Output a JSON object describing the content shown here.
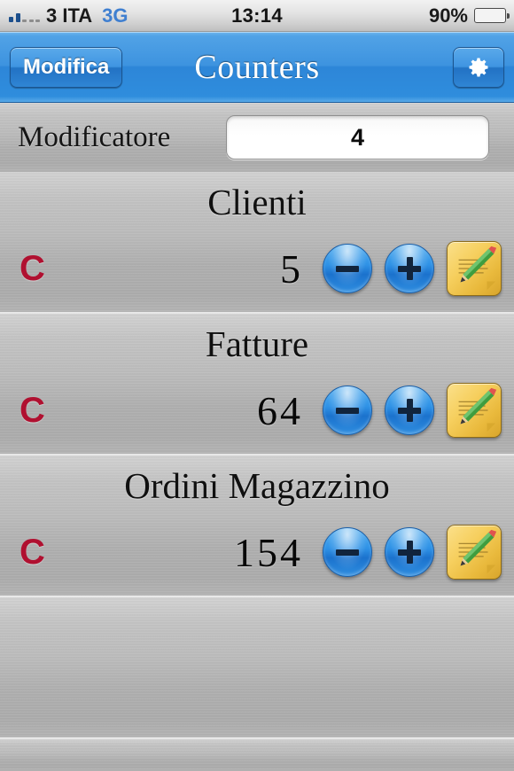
{
  "status_bar": {
    "signal_bars_filled": 2,
    "signal_bars_total": 5,
    "carrier": "3 ITA",
    "network": "3G",
    "time": "13:14",
    "battery_percent_label": "90%",
    "battery_level": 90,
    "battery_color": "#5cc30d"
  },
  "nav": {
    "edit_label": "Modifica",
    "title": "Counters",
    "settings_icon": "gear-icon",
    "bar_color": "#3d93df"
  },
  "modifier": {
    "label": "Modificatore",
    "value": "4",
    "placeholder": "0"
  },
  "counters": [
    {
      "title": "Clienti",
      "value": "5",
      "clear_label": "C",
      "decrement_label": "−",
      "increment_label": "+",
      "note_icon": "note-pencil-icon"
    },
    {
      "title": "Fatture",
      "value": "64",
      "clear_label": "C",
      "decrement_label": "−",
      "increment_label": "+",
      "note_icon": "note-pencil-icon"
    },
    {
      "title": "Ordini Magazzino",
      "value": "154",
      "clear_label": "C",
      "decrement_label": "−",
      "increment_label": "+",
      "note_icon": "note-pencil-icon"
    }
  ],
  "colors": {
    "clear_red": "#b01030",
    "button_blue": "#2f92e6",
    "note_yellow": "#f6cf5e",
    "metal_gray": "#bdbdbd"
  }
}
